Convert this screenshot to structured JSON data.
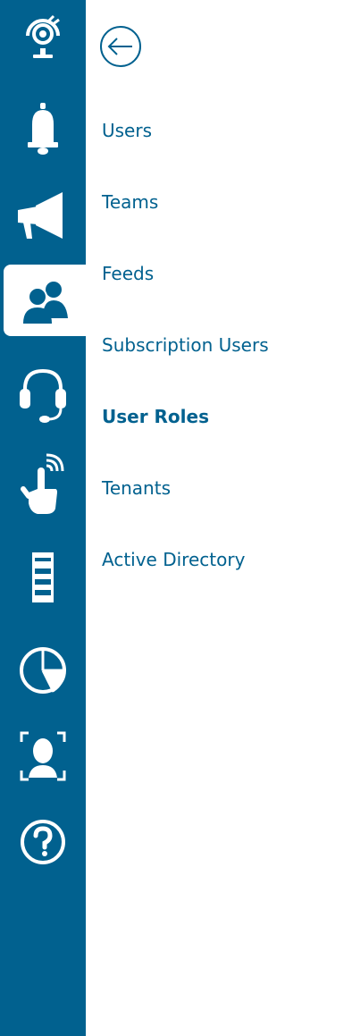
{
  "rail": {
    "items": [
      {
        "icon": "dashboard-icon",
        "active": false
      },
      {
        "icon": "bell-icon",
        "active": false
      },
      {
        "icon": "megaphone-icon",
        "active": false
      },
      {
        "icon": "users-icon",
        "active": true
      },
      {
        "icon": "headset-icon",
        "active": false
      },
      {
        "icon": "touch-icon",
        "active": false
      },
      {
        "icon": "server-icon",
        "active": false
      },
      {
        "icon": "pie-chart-icon",
        "active": false
      },
      {
        "icon": "face-scan-icon",
        "active": false
      },
      {
        "icon": "help-icon",
        "active": false
      }
    ]
  },
  "panel": {
    "back_icon": "back-arrow-icon",
    "links": [
      {
        "label": "Users",
        "active": false
      },
      {
        "label": "Teams",
        "active": false
      },
      {
        "label": "Feeds",
        "active": false
      },
      {
        "label": "Subscription Users",
        "active": false
      },
      {
        "label": "User Roles",
        "active": true
      },
      {
        "label": "Tenants",
        "active": false
      },
      {
        "label": "Active Directory",
        "active": false
      }
    ]
  },
  "colors": {
    "brand": "#01618f",
    "panel_background": "#ffffff",
    "active_item_background": "#ffffff"
  }
}
